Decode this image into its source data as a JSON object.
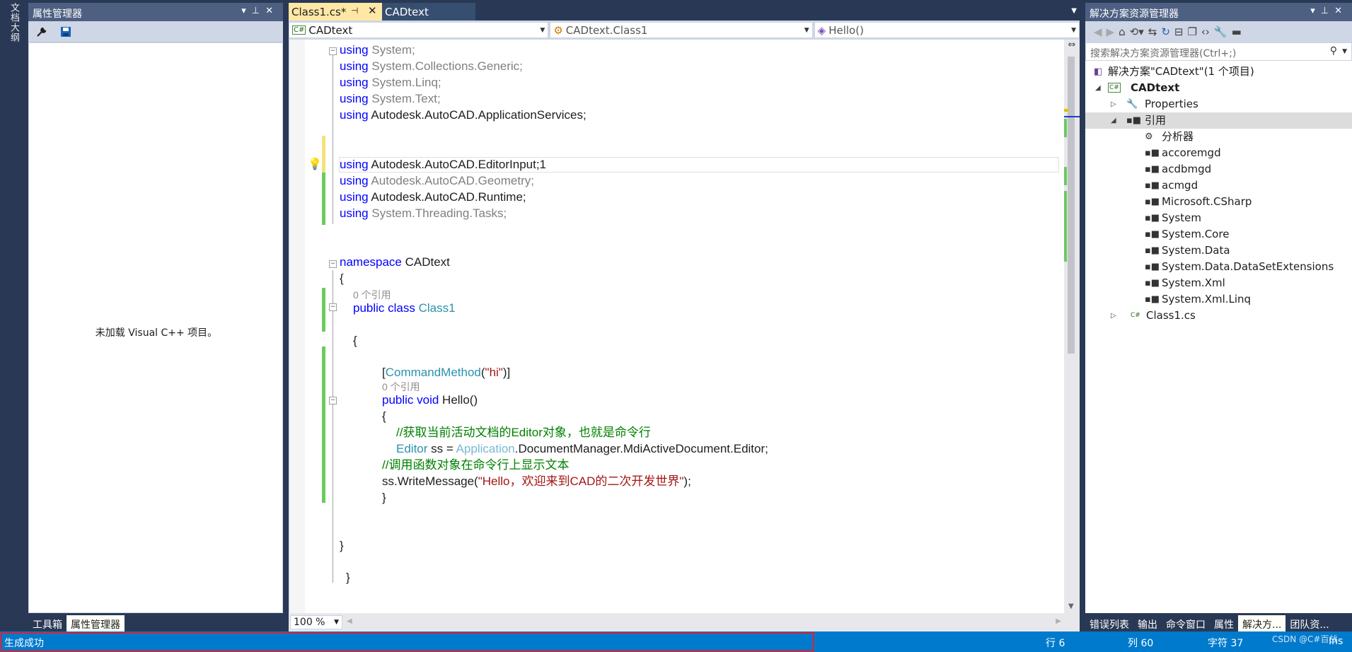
{
  "left_strip": {
    "doc_outline_label": "文档大纲"
  },
  "prop_panel": {
    "title": "属性管理器",
    "empty_message": "未加载 Visual C++ 项目。",
    "bottom_tabs": [
      "工具箱",
      "属性管理器"
    ]
  },
  "editor": {
    "tabs": [
      {
        "label": "Class1.cs*",
        "pin": "⊣",
        "close": "✕"
      },
      {
        "label": "CADtext"
      }
    ],
    "nav": {
      "project": "CADtext",
      "class": "CADtext.Class1",
      "member": "Hello()"
    },
    "code": {
      "l1_kw": "using",
      "l1_rest": " System;",
      "l2_kw": "using",
      "l2_rest": " System.Collections.Generic;",
      "l3_kw": "using",
      "l3_rest": " System.Linq;",
      "l4_kw": "using",
      "l4_rest": " System.Text;",
      "l5_kw": "using",
      "l5_rest": " Autodesk.AutoCAD.ApplicationServices;",
      "l6_kw": "using",
      "l6_rest": " Autodesk.AutoCAD.EditorInput;1",
      "l7_kw": "using",
      "l7_rest": " Autodesk.AutoCAD.Geometry;",
      "l8_kw": "using",
      "l8_rest": " Autodesk.AutoCAD.Runtime;",
      "l9_kw": "using",
      "l9_rest": " System.Threading.Tasks;",
      "ns_kw": "namespace",
      "ns_name": " CADtext",
      "open_brace": "{",
      "ref_count_class": "0 个引用",
      "class_kw": "public class",
      "class_name": " Class1",
      "attr_open": "[",
      "attr_type": "CommandMethod",
      "attr_paren": "(",
      "attr_str": "\"hi\"",
      "attr_close": ")]",
      "ref_count_method": "0 个引用",
      "method_kw": "public void",
      "method_name": " Hello()",
      "comment1": "//获取当前活动文档的Editor对象，也就是命令行",
      "editor_type": "Editor",
      "editor_mid": " ss = ",
      "app_type": "Application",
      "editor_rest": ".DocumentManager.MdiActiveDocument.Editor;",
      "comment2": "//调用函数对象在命令行上显示文本",
      "write_pre": "ss.WriteMessage(",
      "write_str": "\"Hello，欢迎来到CAD的二次开发世界\"",
      "write_post": ");",
      "close_brace": "}"
    },
    "zoom": "100 %"
  },
  "solution": {
    "title": "解决方案资源管理器",
    "search_placeholder": "搜索解决方案资源管理器(Ctrl+;)",
    "tree": [
      {
        "label": "解决方案\"CADtext\"(1 个项目)"
      },
      {
        "label": "CADtext"
      },
      {
        "label": "Properties"
      },
      {
        "label": "引用"
      },
      {
        "label": "分析器"
      },
      {
        "label": "accoremgd"
      },
      {
        "label": "acdbmgd"
      },
      {
        "label": "acmgd"
      },
      {
        "label": "Microsoft.CSharp"
      },
      {
        "label": "System"
      },
      {
        "label": "System.Core"
      },
      {
        "label": "System.Data"
      },
      {
        "label": "System.Data.DataSetExtensions"
      },
      {
        "label": "System.Xml"
      },
      {
        "label": "System.Xml.Linq"
      },
      {
        "label": "Class1.cs"
      }
    ],
    "bottom_tabs": [
      "错误列表",
      "输出",
      "命令窗口",
      "属性",
      "解决方...",
      "团队资..."
    ]
  },
  "status": {
    "text": "生成成功",
    "line": "行 6",
    "col": "列 60",
    "char": "字符 37",
    "ins": "Ins",
    "watermark": "CSDN @C#百战"
  }
}
